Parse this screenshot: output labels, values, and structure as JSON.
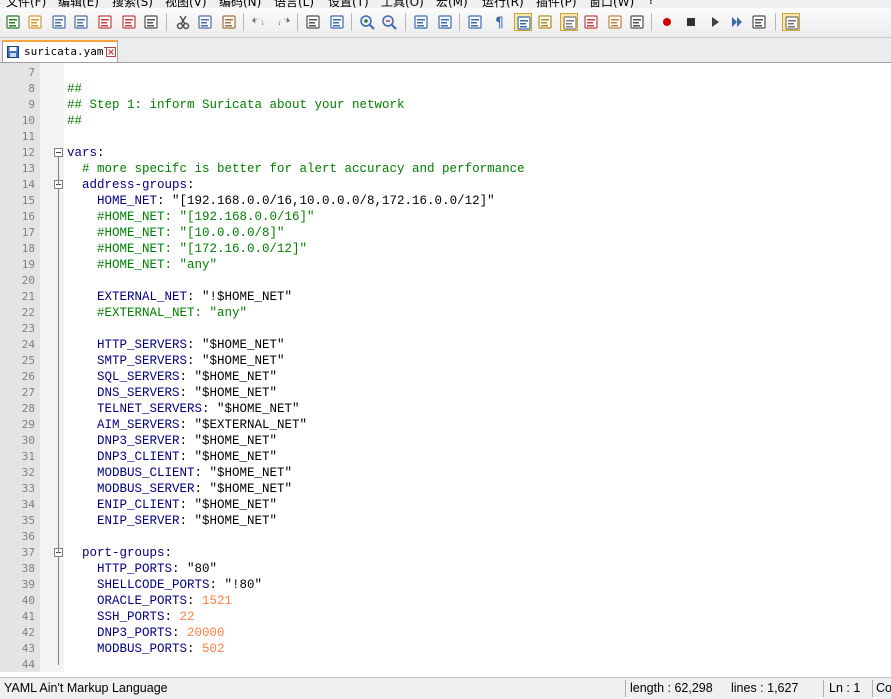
{
  "menu": [
    {
      "label": "文件(F)"
    },
    {
      "label": "编辑(E)"
    },
    {
      "label": "搜索(S)"
    },
    {
      "label": "视图(V)"
    },
    {
      "label": "编码(N)"
    },
    {
      "label": "语言(L)"
    },
    {
      "label": "设置(T)"
    },
    {
      "label": "工具(O)"
    },
    {
      "label": "宏(M)"
    },
    {
      "label": "运行(R)"
    },
    {
      "label": "插件(P)"
    },
    {
      "label": "窗口(W)"
    },
    {
      "label": "?"
    }
  ],
  "toolbar_icons": [
    "new-file-icon",
    "open-file-icon",
    "save-icon",
    "save-all-icon",
    "close-icon",
    "close-all-icon",
    "print-icon",
    "cut-icon",
    "copy-icon",
    "paste-icon",
    "undo-icon",
    "redo-icon",
    "find-icon",
    "replace-icon",
    "zoom-in-icon",
    "zoom-out-icon",
    "sync-vertical-icon",
    "sync-horizontal-icon",
    "word-wrap-icon",
    "show-all-chars-icon",
    "indent-guide-icon",
    "user-language-icon",
    "doc-map-icon",
    "function-list-icon",
    "folder-workspace-icon",
    "monitor-icon",
    "record-macro-icon",
    "stop-record-icon",
    "play-macro-icon",
    "run-multiple-icon",
    "save-macro-icon",
    "launch-browser-icon"
  ],
  "tab": {
    "label": "suricata.yaml"
  },
  "lines": [
    {
      "n": "7",
      "parts": []
    },
    {
      "n": "8",
      "parts": [
        {
          "t": "##",
          "c": "comment"
        }
      ]
    },
    {
      "n": "9",
      "parts": [
        {
          "t": "## Step 1: inform Suricata about your network",
          "c": "comment"
        }
      ]
    },
    {
      "n": "10",
      "parts": [
        {
          "t": "##",
          "c": "comment"
        }
      ]
    },
    {
      "n": "11",
      "parts": []
    },
    {
      "n": "12",
      "parts": [
        {
          "t": "vars",
          "c": "key"
        },
        {
          "t": ":",
          "c": "str"
        }
      ]
    },
    {
      "n": "13",
      "parts": [
        {
          "t": "  # more specifc is better for alert accuracy and performance",
          "c": "comment"
        }
      ]
    },
    {
      "n": "14",
      "parts": [
        {
          "t": "  address-groups",
          "c": "key"
        },
        {
          "t": ":",
          "c": "str"
        }
      ]
    },
    {
      "n": "15",
      "parts": [
        {
          "t": "    HOME_NET",
          "c": "key"
        },
        {
          "t": ": \"[192.168.0.0/16,10.0.0.0/8,172.16.0.0/12]\"",
          "c": "str"
        }
      ]
    },
    {
      "n": "16",
      "parts": [
        {
          "t": "    #HOME_NET: \"[192.168.0.0/16]\"",
          "c": "comment"
        }
      ]
    },
    {
      "n": "17",
      "parts": [
        {
          "t": "    #HOME_NET: \"[10.0.0.0/8]\"",
          "c": "comment"
        }
      ]
    },
    {
      "n": "18",
      "parts": [
        {
          "t": "    #HOME_NET: \"[172.16.0.0/12]\"",
          "c": "comment"
        }
      ]
    },
    {
      "n": "19",
      "parts": [
        {
          "t": "    #HOME_NET: \"any\"",
          "c": "comment"
        }
      ]
    },
    {
      "n": "20",
      "parts": []
    },
    {
      "n": "21",
      "parts": [
        {
          "t": "    EXTERNAL_NET",
          "c": "key"
        },
        {
          "t": ": \"!$HOME_NET\"",
          "c": "str"
        }
      ]
    },
    {
      "n": "22",
      "parts": [
        {
          "t": "    #EXTERNAL_NET: \"any\"",
          "c": "comment"
        }
      ]
    },
    {
      "n": "23",
      "parts": []
    },
    {
      "n": "24",
      "parts": [
        {
          "t": "    HTTP_SERVERS",
          "c": "key"
        },
        {
          "t": ": \"$HOME_NET\"",
          "c": "str"
        }
      ]
    },
    {
      "n": "25",
      "parts": [
        {
          "t": "    SMTP_SERVERS",
          "c": "key"
        },
        {
          "t": ": \"$HOME_NET\"",
          "c": "str"
        }
      ]
    },
    {
      "n": "26",
      "parts": [
        {
          "t": "    SQL_SERVERS",
          "c": "key"
        },
        {
          "t": ": \"$HOME_NET\"",
          "c": "str"
        }
      ]
    },
    {
      "n": "27",
      "parts": [
        {
          "t": "    DNS_SERVERS",
          "c": "key"
        },
        {
          "t": ": \"$HOME_NET\"",
          "c": "str"
        }
      ]
    },
    {
      "n": "28",
      "parts": [
        {
          "t": "    TELNET_SERVERS",
          "c": "key"
        },
        {
          "t": ": \"$HOME_NET\"",
          "c": "str"
        }
      ]
    },
    {
      "n": "29",
      "parts": [
        {
          "t": "    AIM_SERVERS",
          "c": "key"
        },
        {
          "t": ": \"$EXTERNAL_NET\"",
          "c": "str"
        }
      ]
    },
    {
      "n": "30",
      "parts": [
        {
          "t": "    DNP3_SERVER",
          "c": "key"
        },
        {
          "t": ": \"$HOME_NET\"",
          "c": "str"
        }
      ]
    },
    {
      "n": "31",
      "parts": [
        {
          "t": "    DNP3_CLIENT",
          "c": "key"
        },
        {
          "t": ": \"$HOME_NET\"",
          "c": "str"
        }
      ]
    },
    {
      "n": "32",
      "parts": [
        {
          "t": "    MODBUS_CLIENT",
          "c": "key"
        },
        {
          "t": ": \"$HOME_NET\"",
          "c": "str"
        }
      ]
    },
    {
      "n": "33",
      "parts": [
        {
          "t": "    MODBUS_SERVER",
          "c": "key"
        },
        {
          "t": ": \"$HOME_NET\"",
          "c": "str"
        }
      ]
    },
    {
      "n": "34",
      "parts": [
        {
          "t": "    ENIP_CLIENT",
          "c": "key"
        },
        {
          "t": ": \"$HOME_NET\"",
          "c": "str"
        }
      ]
    },
    {
      "n": "35",
      "parts": [
        {
          "t": "    ENIP_SERVER",
          "c": "key"
        },
        {
          "t": ": \"$HOME_NET\"",
          "c": "str"
        }
      ]
    },
    {
      "n": "36",
      "parts": []
    },
    {
      "n": "37",
      "parts": [
        {
          "t": "  port-groups",
          "c": "key"
        },
        {
          "t": ":",
          "c": "str"
        }
      ]
    },
    {
      "n": "38",
      "parts": [
        {
          "t": "    HTTP_PORTS",
          "c": "key"
        },
        {
          "t": ": \"80\"",
          "c": "str"
        }
      ]
    },
    {
      "n": "39",
      "parts": [
        {
          "t": "    SHELLCODE_PORTS",
          "c": "key"
        },
        {
          "t": ": \"!80\"",
          "c": "str"
        }
      ]
    },
    {
      "n": "40",
      "parts": [
        {
          "t": "    ORACLE_PORTS",
          "c": "key"
        },
        {
          "t": ": ",
          "c": "str"
        },
        {
          "t": "1521",
          "c": "num"
        }
      ]
    },
    {
      "n": "41",
      "parts": [
        {
          "t": "    SSH_PORTS",
          "c": "key"
        },
        {
          "t": ": ",
          "c": "str"
        },
        {
          "t": "22",
          "c": "num"
        }
      ]
    },
    {
      "n": "42",
      "parts": [
        {
          "t": "    DNP3_PORTS",
          "c": "key"
        },
        {
          "t": ": ",
          "c": "str"
        },
        {
          "t": "20000",
          "c": "num"
        }
      ]
    },
    {
      "n": "43",
      "parts": [
        {
          "t": "    MODBUS_PORTS",
          "c": "key"
        },
        {
          "t": ": ",
          "c": "str"
        },
        {
          "t": "502",
          "c": "num"
        }
      ]
    },
    {
      "n": "44",
      "parts": []
    }
  ],
  "status": {
    "language": "YAML Ain't Markup Language",
    "length": "length : 62,298",
    "lines": "lines : 1,627",
    "ln": "Ln : 1",
    "col": "Co"
  }
}
